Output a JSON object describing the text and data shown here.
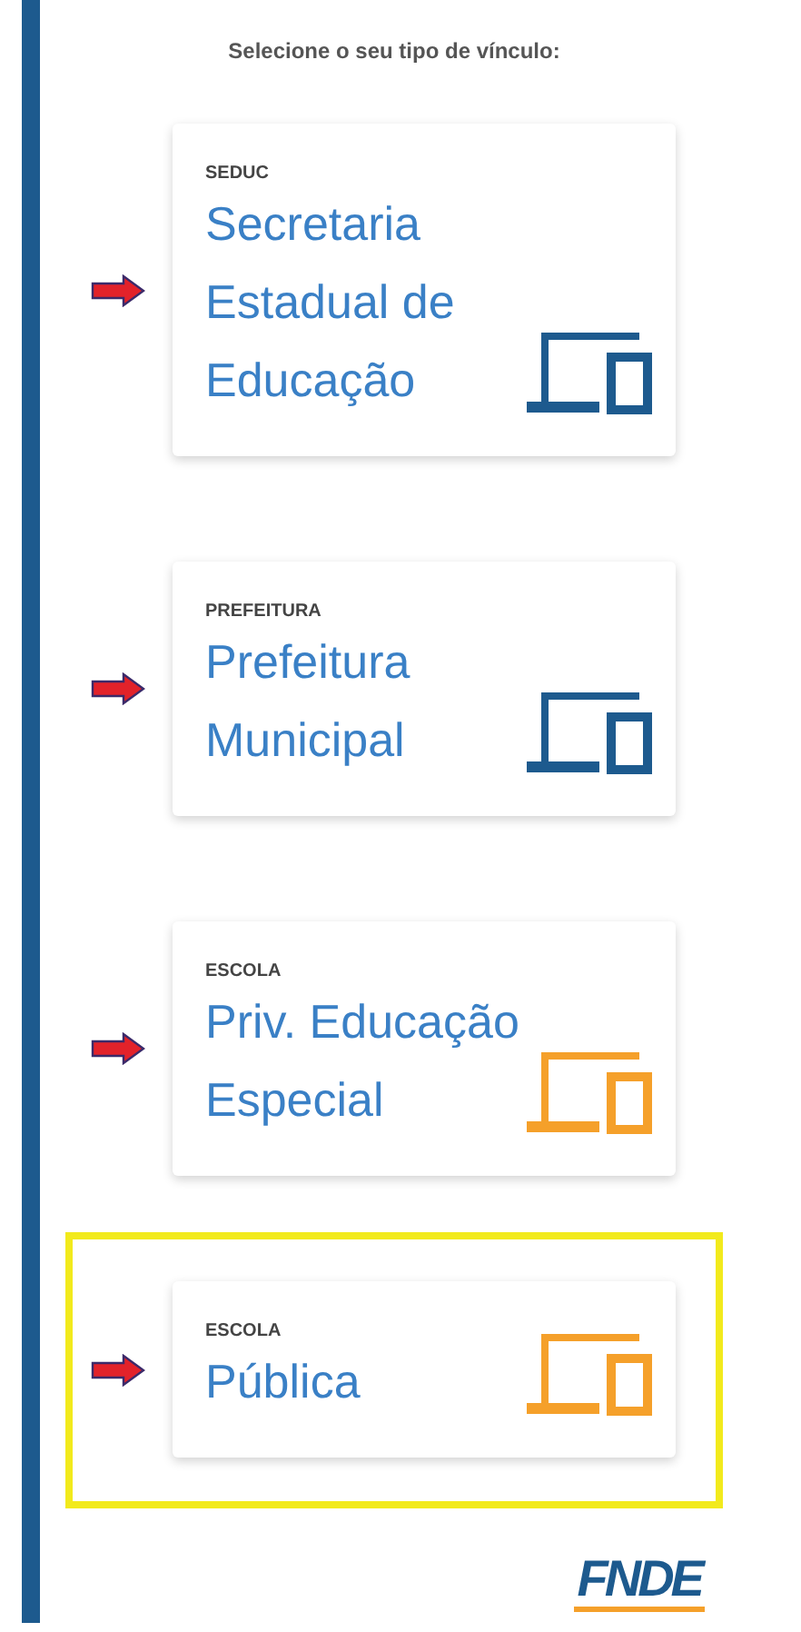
{
  "heading": "Selecione o seu tipo de vínculo:",
  "options": [
    {
      "category": "SEDUC",
      "title": "Secretaria Estadual de Educação",
      "color": "#1d5a8e",
      "highlighted": false
    },
    {
      "category": "PREFEITURA",
      "title": "Prefeitura Municipal",
      "color": "#1d5a8e",
      "highlighted": false
    },
    {
      "category": "ESCOLA",
      "title": "Priv. Educação Especial",
      "color": "#f5a02a",
      "highlighted": false
    },
    {
      "category": "ESCOLA",
      "title": "Pública",
      "color": "#f5a02a",
      "highlighted": true
    }
  ],
  "logo": "FNDE"
}
